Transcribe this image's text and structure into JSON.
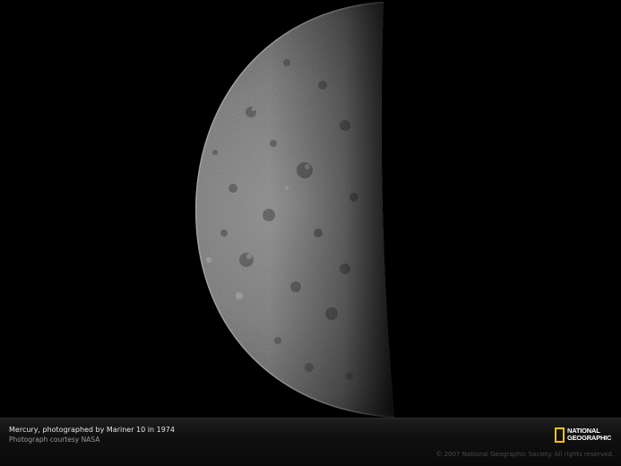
{
  "caption": {
    "title": "Mercury, photographed by Mariner 10 in 1974",
    "credit": "Photograph courtesy NASA"
  },
  "logo": {
    "line1": "NATIONAL",
    "line2": "GEOGRAPHIC",
    "frame_color": "#f6c21c"
  },
  "copyright": "© 2007 National Geographic Society. All rights reserved.",
  "photo": {
    "subject": "mercury-planet-image",
    "background_color": "#000000"
  }
}
